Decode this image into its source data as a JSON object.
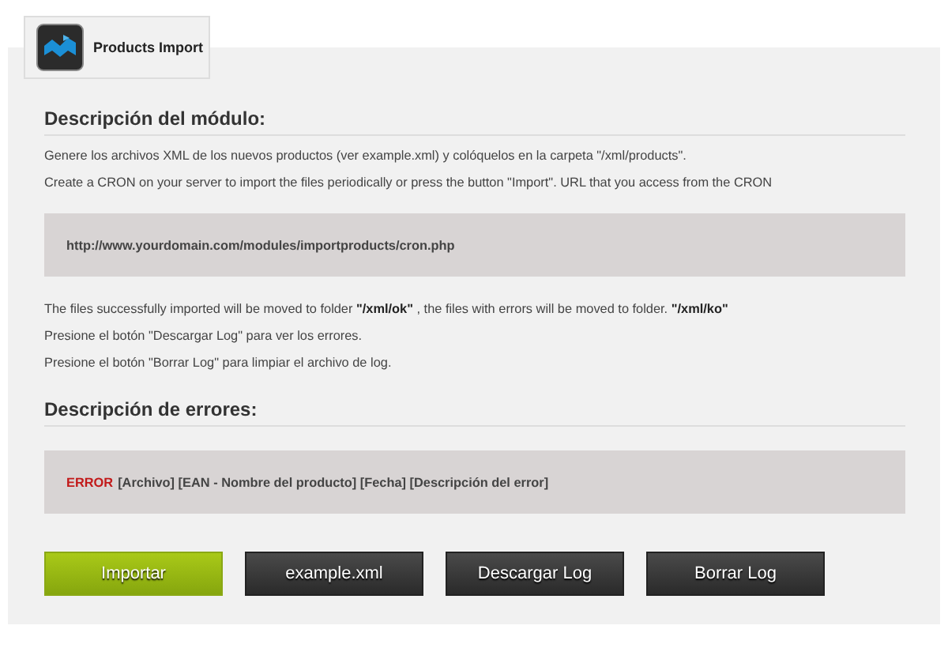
{
  "tab": {
    "title": "Products Import"
  },
  "module_section": {
    "heading": "Descripción del módulo:",
    "intro": [
      "Genere los archivos XML de los nuevos productos (ver example.xml) y colóquelos en la carpeta \"/xml/products\".",
      "Create a CRON on your server to import the files periodically or press the button \"Import\". URL that you access from the CRON"
    ],
    "cron_url": "http://www.yourdomain.com/modules/importproducts/cron.php",
    "notes": [
      "The files successfully imported will be moved to folder **\"/xml/ok\"** , the files with errors will be moved to folder. **\"/xml/ko\"**",
      "Presione el botón \"Descargar Log\" para ver los errores.",
      "Presione el botón \"Borrar Log\" para limpiar el archivo de log."
    ]
  },
  "errors_section": {
    "heading": "Descripción de errores:",
    "error_label": "ERROR",
    "error_format": "[Archivo] [EAN - Nombre del producto] [Fecha] [Descripción del error]"
  },
  "buttons": [
    {
      "label": "Importar",
      "kind": "primary"
    },
    {
      "label": "example.xml",
      "kind": "dark"
    },
    {
      "label": "Descargar Log",
      "kind": "dark"
    },
    {
      "label": "Borrar Log",
      "kind": "dark"
    }
  ]
}
